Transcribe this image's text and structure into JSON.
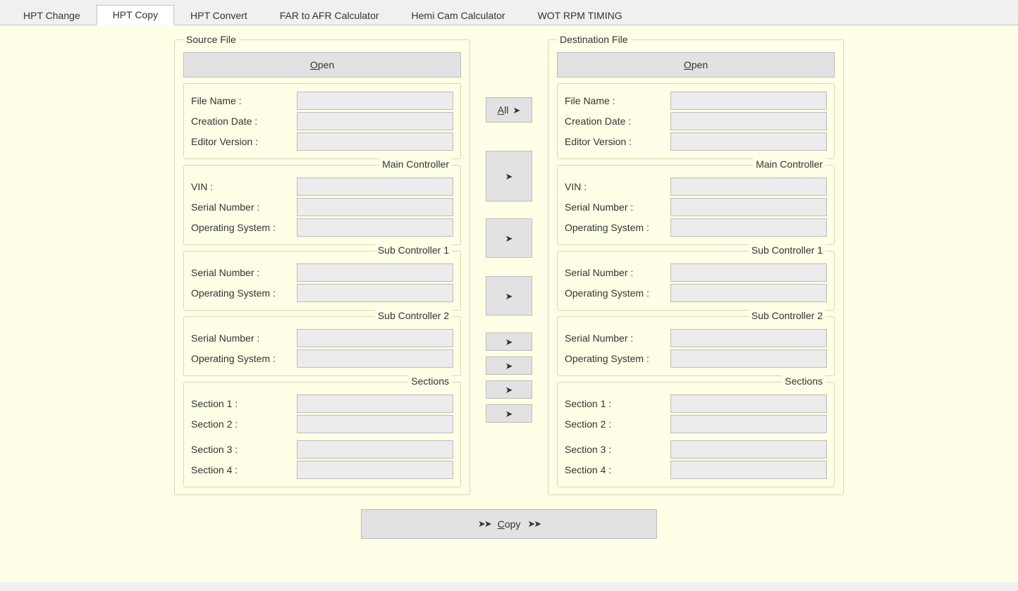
{
  "tabs": [
    {
      "label": "HPT Change"
    },
    {
      "label": "HPT Copy"
    },
    {
      "label": "HPT Convert"
    },
    {
      "label": "FAR to AFR Calculator"
    },
    {
      "label": "Hemi Cam Calculator"
    },
    {
      "label": "WOT RPM TIMING"
    }
  ],
  "active_tab": 1,
  "buttons": {
    "open": "Open",
    "all": "All",
    "copy": "Copy"
  },
  "groups": {
    "source_title": "Source File",
    "dest_title": "Destination File",
    "main_controller": "Main Controller",
    "sub_controller_1": "Sub Controller 1",
    "sub_controller_2": "Sub Controller 2",
    "sections": "Sections"
  },
  "labels": {
    "file_name": "File Name :",
    "creation_date": "Creation Date :",
    "editor_version": "Editor Version :",
    "vin": "VIN :",
    "serial_number": "Serial Number :",
    "operating_system": "Operating System :",
    "section_1": "Section 1 :",
    "section_2": "Section 2 :",
    "section_3": "Section 3 :",
    "section_4": "Section 4 :"
  },
  "source": {
    "file_name": "",
    "creation_date": "",
    "editor_version": "",
    "main": {
      "vin": "",
      "serial_number": "",
      "operating_system": ""
    },
    "sub1": {
      "serial_number": "",
      "operating_system": ""
    },
    "sub2": {
      "serial_number": "",
      "operating_system": ""
    },
    "sections": {
      "s1": "",
      "s2": "",
      "s3": "",
      "s4": ""
    }
  },
  "destination": {
    "file_name": "",
    "creation_date": "",
    "editor_version": "",
    "main": {
      "vin": "",
      "serial_number": "",
      "operating_system": ""
    },
    "sub1": {
      "serial_number": "",
      "operating_system": ""
    },
    "sub2": {
      "serial_number": "",
      "operating_system": ""
    },
    "sections": {
      "s1": "",
      "s2": "",
      "s3": "",
      "s4": ""
    }
  }
}
